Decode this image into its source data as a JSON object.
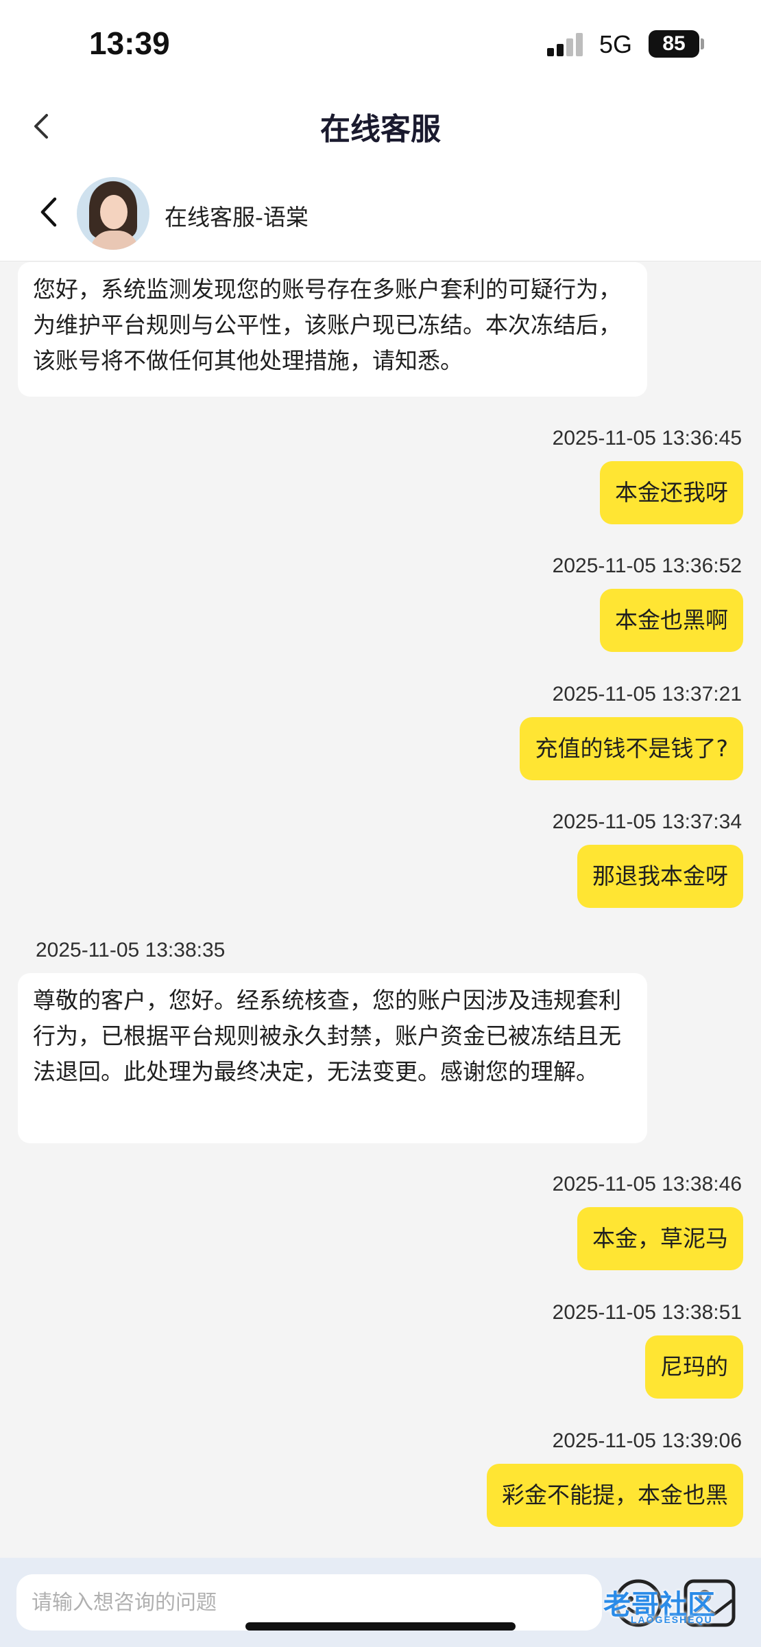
{
  "status": {
    "time": "13:39",
    "network": "5G",
    "battery": "85"
  },
  "header": {
    "title": "在线客服"
  },
  "agent": {
    "name": "在线客服-语棠"
  },
  "messages": [
    {
      "dir": "in",
      "text": "您好，系统监测发现您的账号存在多账户套利的可疑行为，为维护平台规则与公平性，该账户现已冻结。本次冻结后，该账号将不做任何其他处理措施，请知悉。",
      "time": ""
    },
    {
      "dir": "out",
      "time": "2025-11-05 13:36:45",
      "text": "本金还我呀"
    },
    {
      "dir": "out",
      "time": "2025-11-05 13:36:52",
      "text": "本金也黑啊"
    },
    {
      "dir": "out",
      "time": "2025-11-05 13:37:21",
      "text": "充值的钱不是钱了?"
    },
    {
      "dir": "out",
      "time": "2025-11-05 13:37:34",
      "text": "那退我本金呀"
    },
    {
      "dir": "in",
      "time": "2025-11-05 13:38:35",
      "text": "尊敬的客户，您好。经系统核查，您的账户因涉及违规套利行为，已根据平台规则被永久封禁，账户资金已被冻结且无法退回。此处理为最终决定，无法变更。感谢您的理解。"
    },
    {
      "dir": "out",
      "time": "2025-11-05 13:38:46",
      "text": "本金，草泥马"
    },
    {
      "dir": "out",
      "time": "2025-11-05 13:38:51",
      "text": "尼玛的"
    },
    {
      "dir": "out",
      "time": "2025-11-05 13:39:06",
      "text": "彩金不能提，本金也黑"
    }
  ],
  "input": {
    "placeholder": "请输入想咨询的问题"
  },
  "icons": [
    "back-icon",
    "emoji-icon",
    "image-icon",
    "signal-icon",
    "battery-icon"
  ],
  "colors": {
    "outgoing_bubble": "#ffe533",
    "incoming_bubble": "#ffffff",
    "background": "#f4f4f4",
    "input_bar": "#e6ecf5"
  },
  "watermark": {
    "text": "老哥社区",
    "sub": "LAOGESHEQU"
  }
}
